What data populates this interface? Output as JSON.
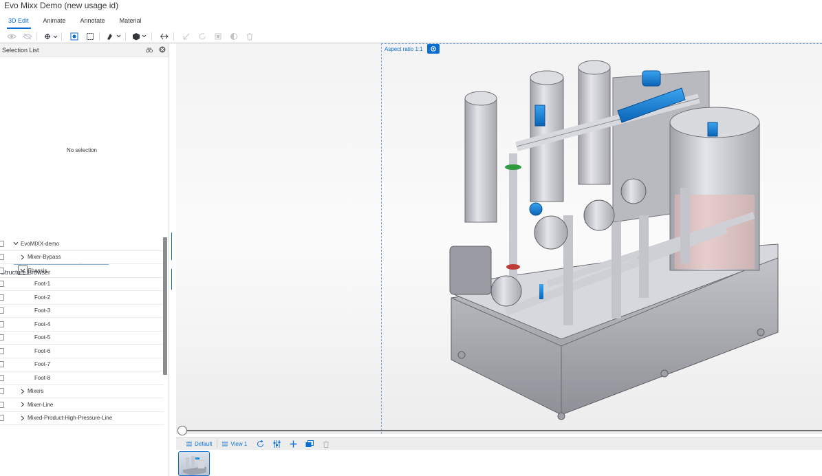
{
  "header": {
    "title": "Evo Mixx Demo (new usage id)",
    "tabs": [
      {
        "label": "3D Edit",
        "active": true
      },
      {
        "label": "Animate",
        "active": false
      },
      {
        "label": "Annotate",
        "active": false
      },
      {
        "label": "Material",
        "active": false
      }
    ]
  },
  "toolbar": {
    "icons": [
      "show-icon",
      "hide-icon",
      "rotate-mode-icon",
      "fit-view-icon",
      "selection-box-icon",
      "paint-icon",
      "render-mode-icon",
      "transform-icon",
      "move-icon",
      "rotate-icon",
      "scale-icon",
      "opacity-icon",
      "delete-icon"
    ]
  },
  "selection_list": {
    "title": "Selection List",
    "empty_text": "No selection"
  },
  "structure_browser": {
    "title": "Structure Browser",
    "items": [
      {
        "label": "EvoMIXX-demo",
        "level": 0,
        "toggle": "expanded"
      },
      {
        "label": "Mixer-Bypass",
        "level": 1,
        "toggle": "collapsed"
      },
      {
        "label": "Chassis",
        "level": 1,
        "toggle": "expanded",
        "focused": true
      },
      {
        "label": "Foot-1",
        "level": 2,
        "toggle": "none"
      },
      {
        "label": "Foot-2",
        "level": 2,
        "toggle": "none"
      },
      {
        "label": "Foot-3",
        "level": 2,
        "toggle": "none"
      },
      {
        "label": "Foot-4",
        "level": 2,
        "toggle": "none"
      },
      {
        "label": "Foot-5",
        "level": 2,
        "toggle": "none"
      },
      {
        "label": "Foot-6",
        "level": 2,
        "toggle": "none"
      },
      {
        "label": "Foot-7",
        "level": 2,
        "toggle": "none"
      },
      {
        "label": "Foot-8",
        "level": 2,
        "toggle": "none"
      },
      {
        "label": "Mixers",
        "level": 1,
        "toggle": "collapsed"
      },
      {
        "label": "Mixer-Line",
        "level": 1,
        "toggle": "collapsed"
      },
      {
        "label": "Mixed-Product-High-Pressure-Line",
        "level": 1,
        "toggle": "collapsed"
      }
    ]
  },
  "viewport": {
    "aspect_label": "Aspect ratio 1:1"
  },
  "bottom_bar": {
    "default_label": "Default",
    "view_label": "View 1"
  },
  "colors": {
    "accent": "#0a6ed1",
    "model_blue": "#1a8be0",
    "model_gray": "#c8c9cf"
  }
}
